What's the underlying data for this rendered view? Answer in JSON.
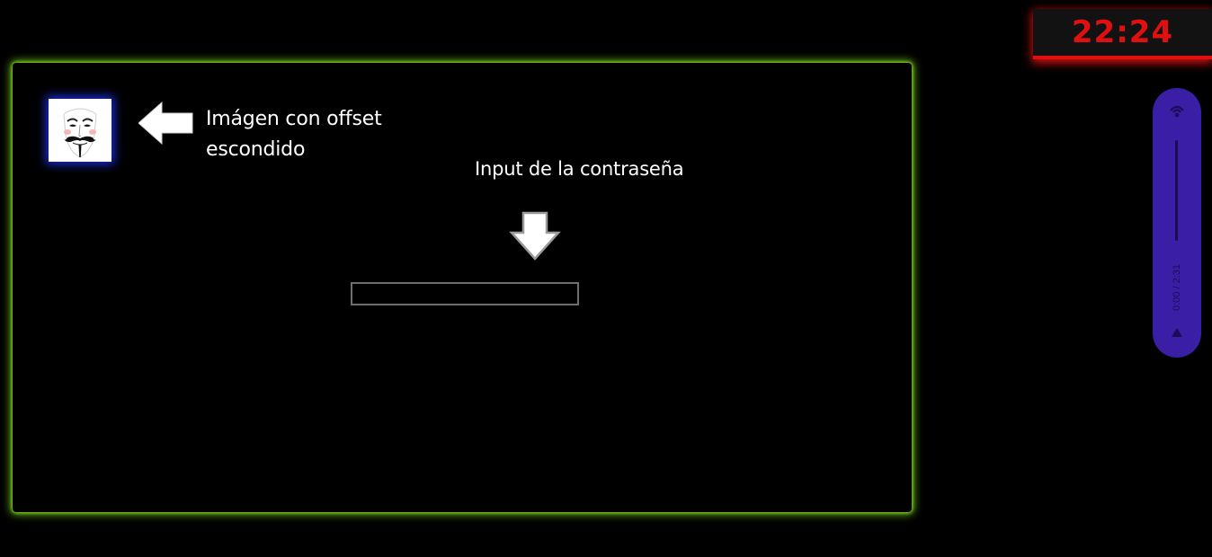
{
  "annotations": {
    "image_note": "Imágen con offset\nescondido",
    "image_note_line1": "Imágen con offset",
    "image_note_line2": "escondido",
    "input_note": "Input de la contraseña"
  },
  "password": {
    "value": "",
    "placeholder": ""
  },
  "clock": {
    "time": "22:24"
  },
  "player": {
    "time_display": "0:00 / 2:31",
    "volume_icon": "volume-icon",
    "play_icon": "play-icon"
  },
  "colors": {
    "panel_glow": "#6fbf1c",
    "avatar_glow": "#1a2bd6",
    "clock_red": "#e01010",
    "player_bg": "#3b1ea6"
  },
  "icons": {
    "avatar": "guy-fawkes-mask-icon",
    "left_arrow": "arrow-left-icon",
    "down_arrow": "arrow-down-icon"
  }
}
